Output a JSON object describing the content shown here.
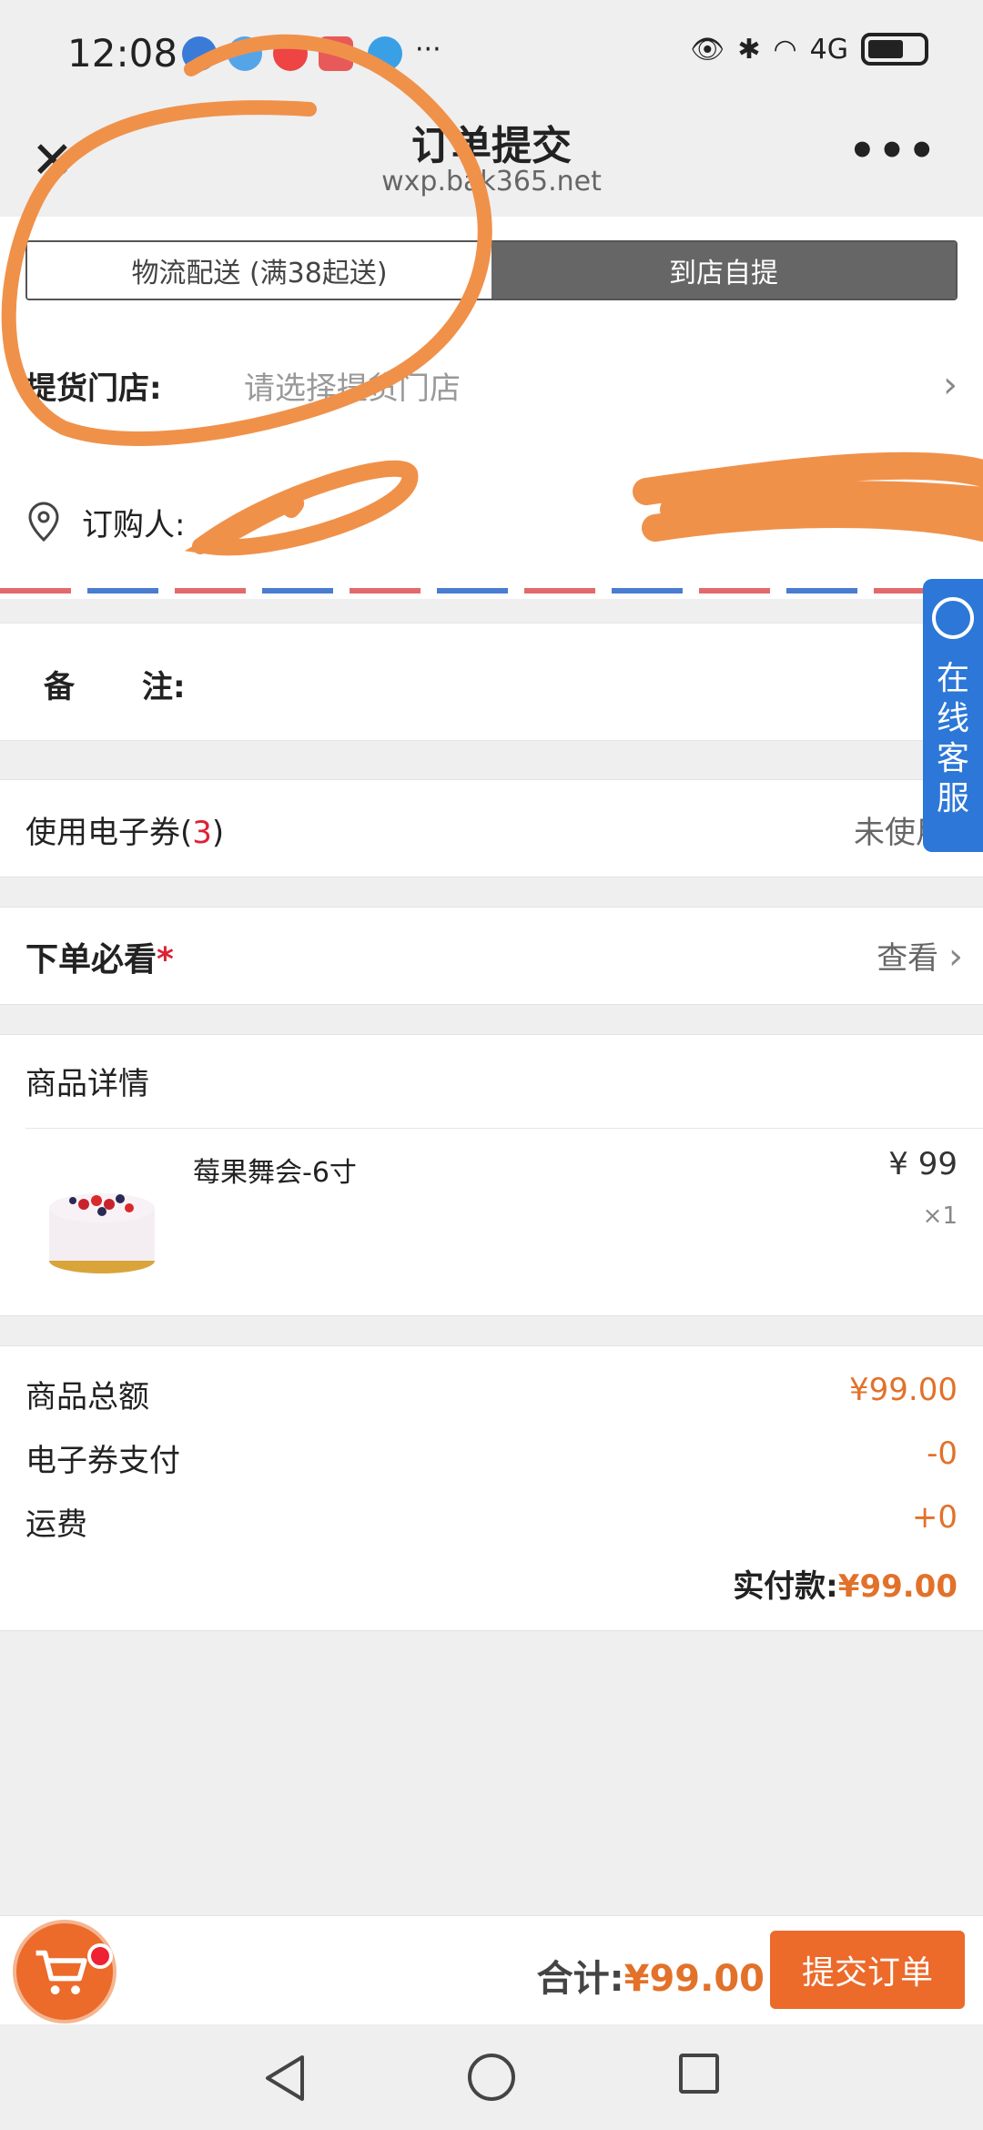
{
  "status": {
    "time": "12:08",
    "network": "4G"
  },
  "header": {
    "title": "订单提交",
    "url": "wxp.bak365.net",
    "close_icon": "close-icon",
    "more": "•••"
  },
  "delivery": {
    "tab_logistics": "物流配送 (满38起送)",
    "tab_pickup": "到店自提",
    "store_label": "提货门店:",
    "store_placeholder": "请选择提货门店",
    "buyer_label": "订购人:"
  },
  "remark": {
    "label_a": "备",
    "label_b": "注:"
  },
  "coupon": {
    "label": "使用电子券(",
    "count": "3",
    "close": ")",
    "status": "未使用"
  },
  "notice": {
    "label": "下单必看",
    "star": "*",
    "action": "查看"
  },
  "goods": {
    "header": "商品详情",
    "items": [
      {
        "name": "莓果舞会-6寸",
        "price": "¥ 99",
        "qty": "×1"
      }
    ]
  },
  "summary": {
    "total_label": "商品总额",
    "total_value": "¥99.00",
    "coupon_label": "电子券支付",
    "coupon_value": "-0",
    "shipping_label": "运费",
    "shipping_value": "+0",
    "paid_label": "实付款:",
    "paid_value": "¥99.00"
  },
  "footer": {
    "sum_label": "合计:",
    "sum_value": "¥99.00",
    "submit": "提交订单"
  },
  "service": {
    "label": "在线客服"
  },
  "colors": {
    "accent": "#ec6a2a",
    "service": "#2c77d8",
    "scribble": "#f0914a"
  }
}
